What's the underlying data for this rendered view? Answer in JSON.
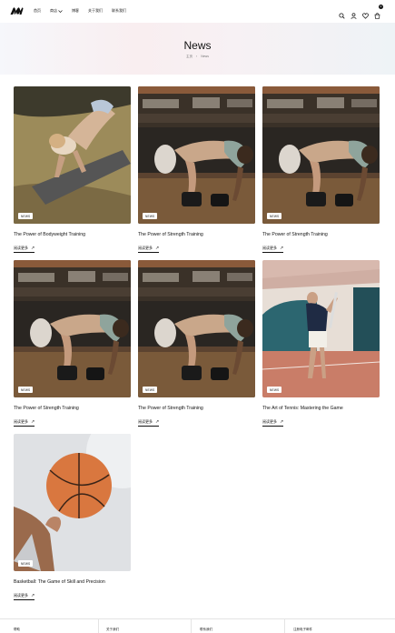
{
  "header": {
    "nav": [
      {
        "label": "首页"
      },
      {
        "label": "商店"
      },
      {
        "label": "博客"
      },
      {
        "label": "关于我们"
      },
      {
        "label": "联系我们"
      }
    ],
    "cart_count": "0"
  },
  "hero": {
    "title": "News",
    "breadcrumb_home": "主页",
    "breadcrumb_sep": "›",
    "breadcrumb_current": "News"
  },
  "posts": [
    {
      "tag": "NEWS",
      "title": "The Power of Bodyweight Training",
      "read_more": "阅读更多"
    },
    {
      "tag": "NEWS",
      "title": "The Power of Strength Training",
      "read_more": "阅读更多"
    },
    {
      "tag": "NEWS",
      "title": "The Power of Strength Training",
      "read_more": "阅读更多"
    },
    {
      "tag": "NEWS",
      "title": "The Power of Strength Training",
      "read_more": "阅读更多"
    },
    {
      "tag": "NEWS",
      "title": "The Power of Strength Training",
      "read_more": "阅读更多"
    },
    {
      "tag": "NEWS",
      "title": "The Art of Tennis: Mastering the Game",
      "read_more": "阅读更多"
    },
    {
      "tag": "NEWS",
      "title": "Basketball: The Game of Skill and Precision",
      "read_more": "阅读更多"
    }
  ],
  "footer": {
    "cols": [
      "帮助",
      "关于我们",
      "联系我们",
      "注册电子邮件"
    ]
  }
}
